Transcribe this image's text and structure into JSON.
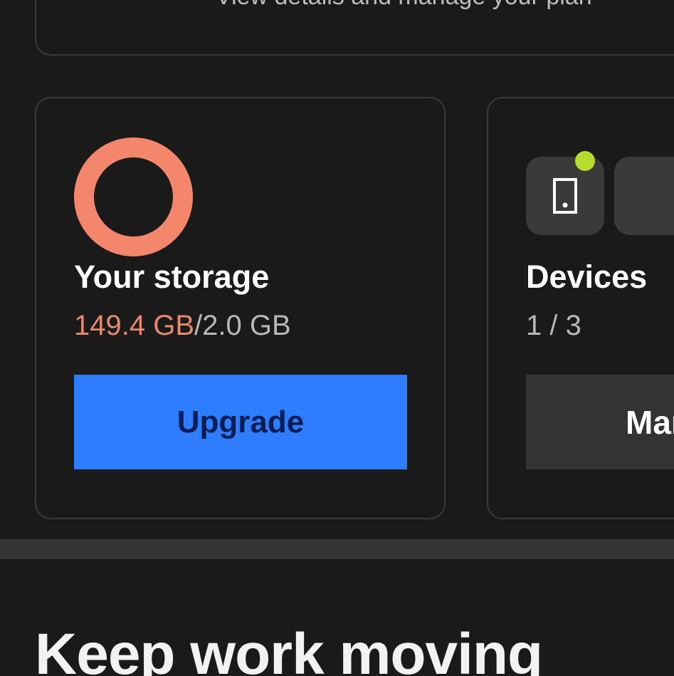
{
  "plan": {
    "description": "View details and manage your plan"
  },
  "storage": {
    "title": "Your storage",
    "used": "149.4 GB",
    "separator": "/",
    "total": "2.0 GB",
    "upgrade_label": "Upgrade"
  },
  "devices": {
    "title": "Devices",
    "count": "1 / 3",
    "manage_label": "Manage"
  },
  "section": {
    "heading": "Keep work moving"
  },
  "colors": {
    "background": "#1a1a1a",
    "ring": "#f4876b",
    "used_text": "#e58a6c",
    "upgrade_button": "#2f7dff",
    "online_dot": "#b7dd2c"
  }
}
